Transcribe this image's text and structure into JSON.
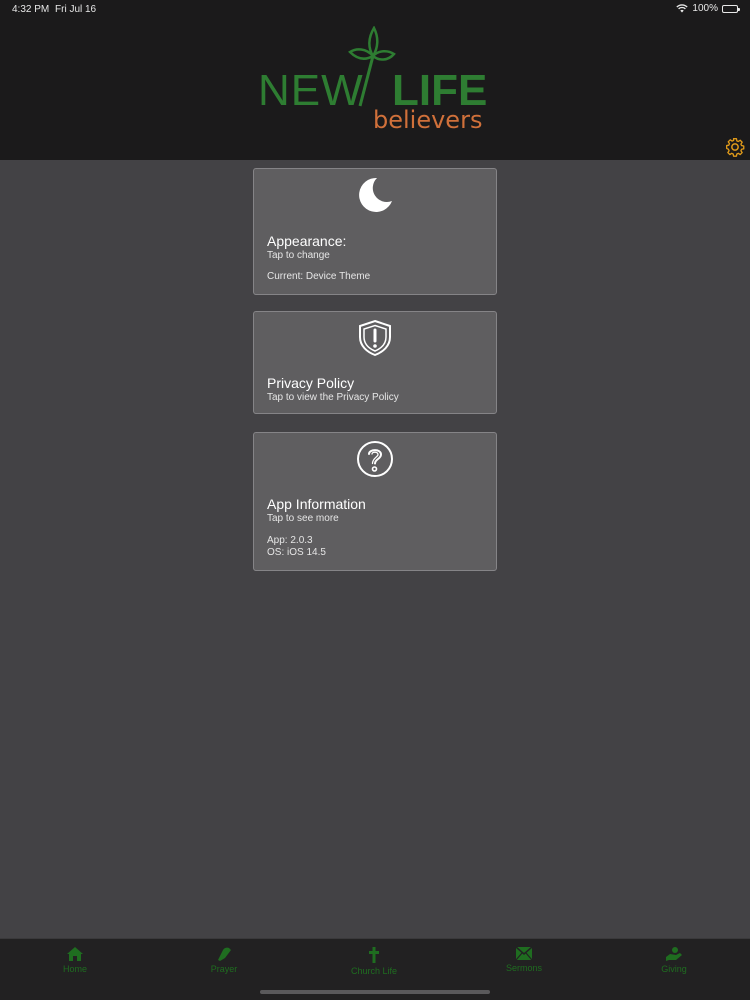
{
  "status_bar": {
    "time": "4:32 PM",
    "date": "Fri Jul 16",
    "battery": "100%"
  },
  "header": {
    "logo": {
      "word1": "NEW",
      "word2": "LIFE",
      "word3": "believers"
    }
  },
  "cards": {
    "appearance": {
      "title": "Appearance:",
      "subtitle": "Tap to change",
      "info": "Current: Device Theme"
    },
    "privacy": {
      "title": "Privacy Policy",
      "subtitle": "Tap to view the Privacy Policy"
    },
    "app_info": {
      "title": "App Information",
      "subtitle": "Tap to see more",
      "app_version": "App: 2.0.3",
      "os_version": "OS: iOS 14.5"
    }
  },
  "tabs": {
    "home": "Home",
    "prayer": "Prayer",
    "church_life": "Church Life",
    "sermons": "Sermons",
    "giving": "Giving"
  },
  "colors": {
    "accent_green": "#2e7d32",
    "accent_orange": "#d0703a",
    "tab_green": "#1f6d20",
    "gear_orange": "#e09a1a"
  }
}
